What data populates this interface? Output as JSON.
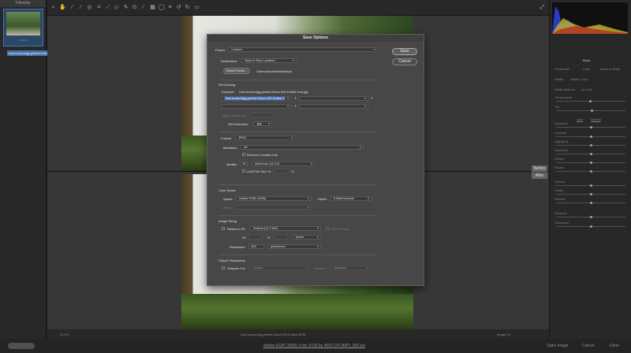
{
  "filmstrip": {
    "title": "Filmstrip",
    "stars": "• • • • •",
    "filename": "Huis.bosschrijg.gebied.Edam-WS-Edited.ARW"
  },
  "canvas": {
    "before_label": "Before",
    "after_label": "After"
  },
  "statusbar": {
    "zoom": "24.9%",
    "filename": "Huis.bosschrijg.gebied.Edam-WS-Edited.ARW",
    "position": "Image 1/1"
  },
  "bottombar": {
    "info": "Adobe RGB (1998); 8 bit; 6106 by 4069 (24.9MP); 300 ppi",
    "open_label": "Open Image",
    "cancel_label": "Cancel",
    "done_label": "Done"
  },
  "rightpanel": {
    "tab": "Basic",
    "treatment": "Treatment:",
    "color": "Color",
    "bw": "Black & White",
    "profile_label": "Profile:",
    "profile_value": "Adobe Color",
    "wb_label": "White Balance:",
    "wb_value": "As Shot",
    "temp": "Temperature",
    "tint": "Tint",
    "auto": "Auto",
    "default": "Default",
    "sliders": [
      "Exposure",
      "Contrast",
      "Highlights",
      "Shadows",
      "Whites",
      "Blacks",
      "Texture",
      "Clarity",
      "Dehaze",
      "Vibrance",
      "Saturation"
    ]
  },
  "dialog": {
    "title": "Save Options",
    "save_label": "Save",
    "cancel_label": "Cancel",
    "preset_label": "Preset:",
    "preset_value": "Custom",
    "destination_label": "Destination:",
    "destination_value": "Save in New Location",
    "select_folder": "Select Folder...",
    "folder_path": "/Users/donavrie/Desktop/",
    "file_naming_title": "File Naming",
    "example_label": "Example:",
    "example_value": "Huis.bosschrijg.gebied.Edam-WS-Edited.One.jpg",
    "name_field1": "Huis.bosschrijg.gebied.Edam-WS-Edited.O",
    "begin_numbering": "Begin Numbering:",
    "file_ext_label": "File Extension:",
    "file_ext_value": ".jpg",
    "format_label": "Format:",
    "format_value": "JPEG",
    "metadata_label": "Metadata:",
    "metadata_value": "All",
    "remove_location": "Remove Location Info",
    "quality_label": "Quality:",
    "quality_value": "10",
    "quality_select": "Maximum  (10-12)",
    "limit_file": "Limit File Size To:",
    "limit_unit": "K",
    "color_space_title": "Color Space",
    "space_label": "Space:",
    "space_value": "Adobe RGB (1998)",
    "depth_label": "Depth:",
    "depth_value": "8 Bits/Channel",
    "intent_label": "Intent:",
    "image_sizing_title": "Image Sizing",
    "resize_label": "Resize to Fit:",
    "resize_value": "Default  (12.2 MP)",
    "dont_enlarge": "Don't Enlarge",
    "w_label": "W:",
    "h_label": "H:",
    "pixels": "pixels",
    "resolution_label": "Resolution:",
    "resolution_value": "300",
    "resolution_unit": "pixels/inch",
    "output_sharpening_title": "Output Sharpening",
    "sharpen_label": "Sharpen For:",
    "sharpen_value": "Screen",
    "amount_label": "Amount:",
    "amount_value": "Standard"
  },
  "colors": {
    "accent": "#3b6fc2",
    "dialog_bg": "#474747",
    "panel_bg": "#2b2b2b"
  }
}
